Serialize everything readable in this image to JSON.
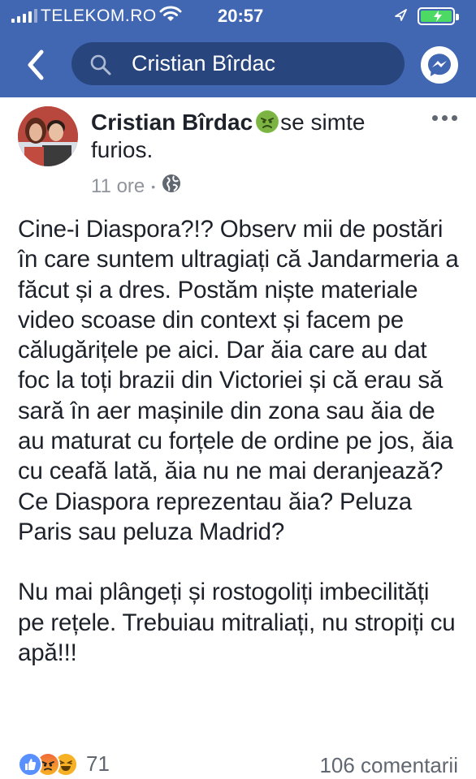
{
  "status_bar": {
    "carrier": "TELEKOM.RO",
    "time": "20:57",
    "signal_icon": "signal-bars-icon",
    "wifi_icon": "wifi-icon",
    "location_icon": "location-arrow-icon",
    "battery_icon": "battery-charging-icon"
  },
  "nav": {
    "back_icon": "chevron-left-icon",
    "search_icon": "search-icon",
    "search_text": "Cristian Bîrdac",
    "messenger_icon": "messenger-icon"
  },
  "post": {
    "author": "Cristian Bîrdac",
    "feeling_emoji": "angry-face-emoji",
    "feeling_text": "se simte furios.",
    "time": "11 ore",
    "separator": "•",
    "privacy_icon": "globe-icon",
    "more_icon": "more-dots-icon",
    "paragraphs": [
      "Cine-i Diaspora?!? Observ mii de postări în care suntem ultragiați că Jandarmeria a făcut și a dres. Postăm niște materiale video scoase din context și facem pe călugărițele pe aici. Dar ăia care au dat foc la toți brazii din Victoriei și că erau să sară în aer mașinile din zona sau ăia de au maturat cu forțele de ordine pe jos, ăia cu ceafă lată, ăia nu ne mai deranjează? Ce Diaspora reprezentau ăia? Peluza Paris sau peluza Madrid?",
      "Nu mai plângeți și rostogoliți imbecilități pe rețele. Trebuiau mitraliați, nu stropiți cu apă!!!"
    ]
  },
  "footer": {
    "reaction_icons": [
      "like-reaction-icon",
      "angry-reaction-icon",
      "haha-reaction-icon"
    ],
    "reaction_count": "71",
    "comments": "106 comentarii"
  },
  "colors": {
    "brand_blue": "#4267b2",
    "search_bg": "#28457e",
    "text": "#1d2129",
    "meta": "#90949c"
  }
}
